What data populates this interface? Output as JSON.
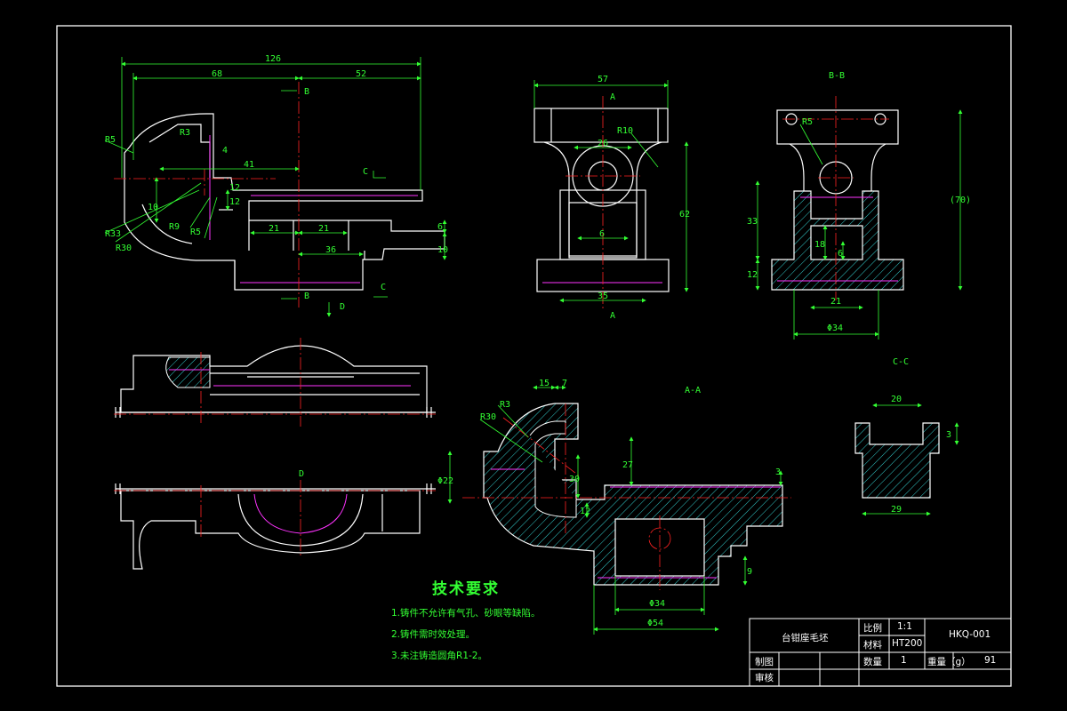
{
  "colors": {
    "background": "#000000",
    "outline": "#ffffff",
    "centerline": "#ff2222",
    "hidden": "#ff33ff",
    "hatch": "#33cccc",
    "dimension": "#33ff33"
  },
  "dims": {
    "d126": "126",
    "d68": "68",
    "d52": "52",
    "r5a": "R5",
    "r3a": "R3",
    "d4a": "4",
    "d41": "41",
    "d12a": "12",
    "d10a": "10",
    "d12b": "12",
    "d21a": "21",
    "d21b": "21",
    "d36": "36",
    "d6a": "6",
    "d10b": "10",
    "r33": "R33",
    "r9": "R9",
    "r5b": "R5",
    "r30a": "R30",
    "d57": "57",
    "d26": "26",
    "r10": "R10",
    "d62": "62",
    "d6b": "6",
    "d35": "35",
    "r5c": "R5",
    "d70": "(70)",
    "d33": "33",
    "d18": "18",
    "d6c": "6",
    "d12c": "12",
    "d21c": "21",
    "phi34a": "Φ34",
    "d20": "20",
    "d3a": "3",
    "d29": "29",
    "d15": "15",
    "d7": "7",
    "r3b": "R3",
    "r30b": "R30",
    "phi22": "Φ22",
    "d30": "30",
    "d27": "27",
    "d3b": "3",
    "d12d": "12",
    "d9": "9",
    "phi34b": "Φ34",
    "phi54": "Φ54"
  },
  "labels": {
    "b_top": "B",
    "b_bot": "B",
    "c_top": "C",
    "c_bot": "C",
    "d_arrow": "D",
    "a_top": "A",
    "a_bot": "A",
    "bb": "B-B",
    "cc": "C-C",
    "aa": "A-A",
    "d_view": "D"
  },
  "notes": {
    "title": "技术要求",
    "items": [
      "1.铸件不允许有气孔、砂眼等缺陷。",
      "2.铸件需时效处理。",
      "3.未注铸造圆角R1-2。"
    ]
  },
  "title_block": {
    "part_name": "台钳座毛坯",
    "scale_label": "比例",
    "scale_value": "1:1",
    "material_label": "材料",
    "material_value": "HT200",
    "drawing_no": "HKQ-001",
    "drawn_label": "制图",
    "quantity_label": "数量",
    "quantity_value": "1",
    "weight_label": "重量（g）",
    "weight_value": "91",
    "checked_label": "审核"
  }
}
